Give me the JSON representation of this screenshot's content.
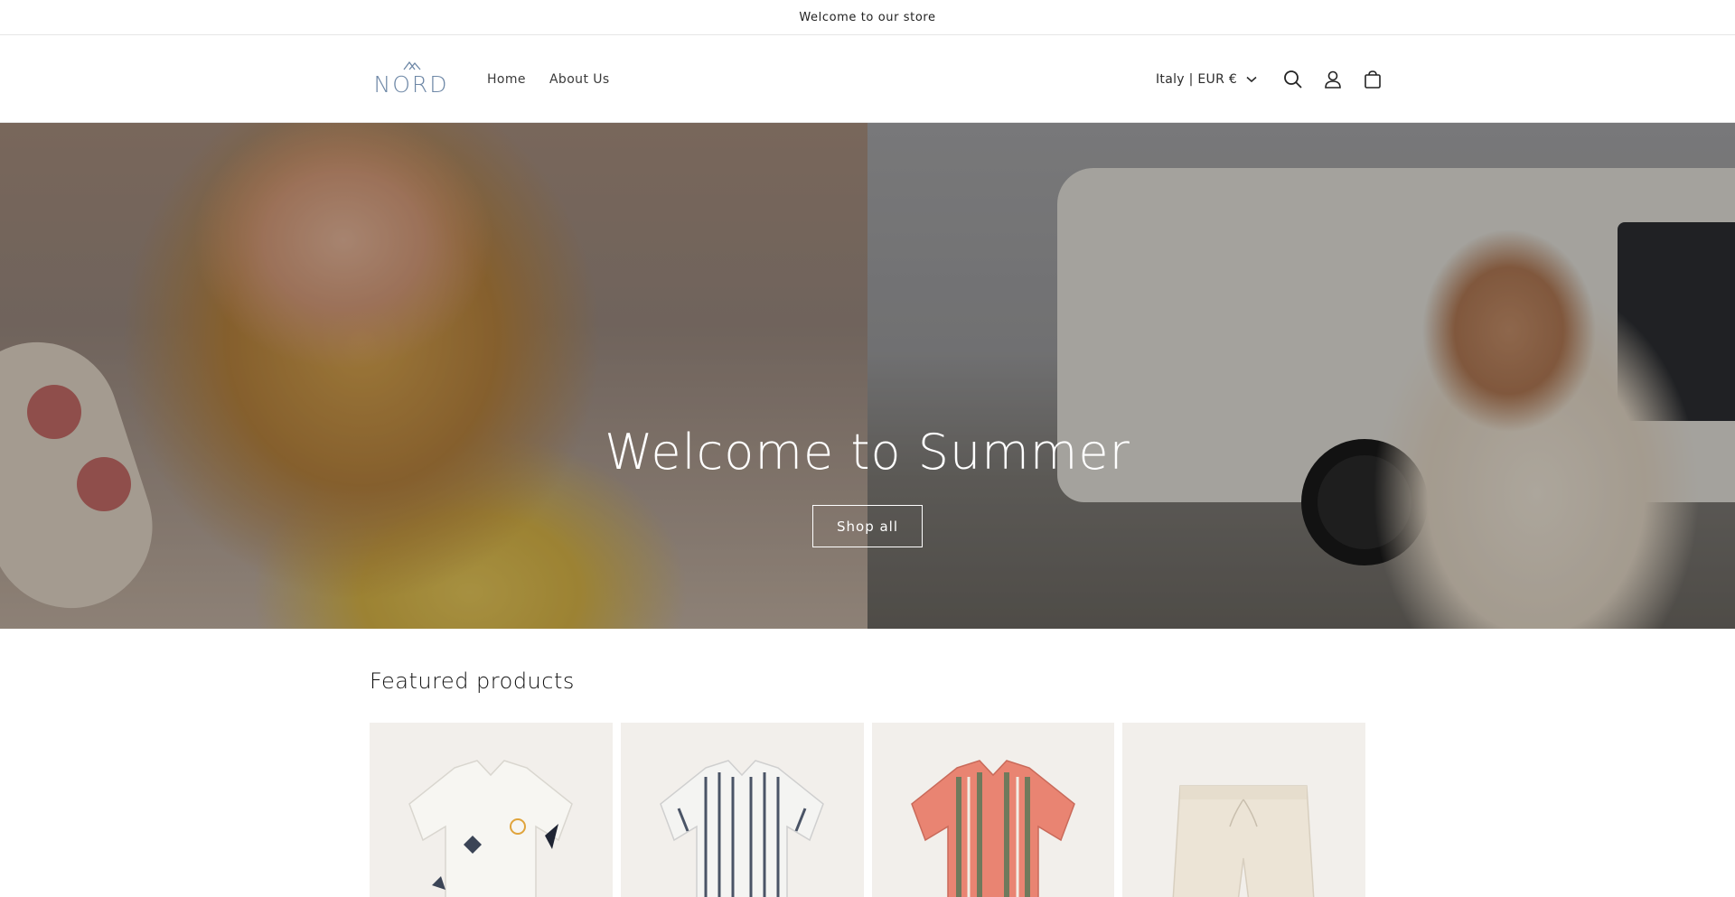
{
  "announcement": {
    "text": "Welcome to our store"
  },
  "header": {
    "logo_text": "NORD",
    "nav": [
      {
        "label": "Home"
      },
      {
        "label": "About Us"
      }
    ],
    "locale": "Italy | EUR €",
    "icons": [
      "search-icon",
      "account-icon",
      "cart-icon"
    ]
  },
  "hero": {
    "title": "Welcome to Summer",
    "button_label": "Shop all"
  },
  "featured": {
    "title": "Featured products",
    "products": [
      {
        "image": "white-printed-shirt"
      },
      {
        "image": "striped-navy-white-shirt"
      },
      {
        "image": "striped-red-green-shirt"
      },
      {
        "image": "cream-linen-shorts"
      }
    ]
  },
  "colors": {
    "logo": "#6d87a6",
    "card_background": "#f2efeb"
  }
}
